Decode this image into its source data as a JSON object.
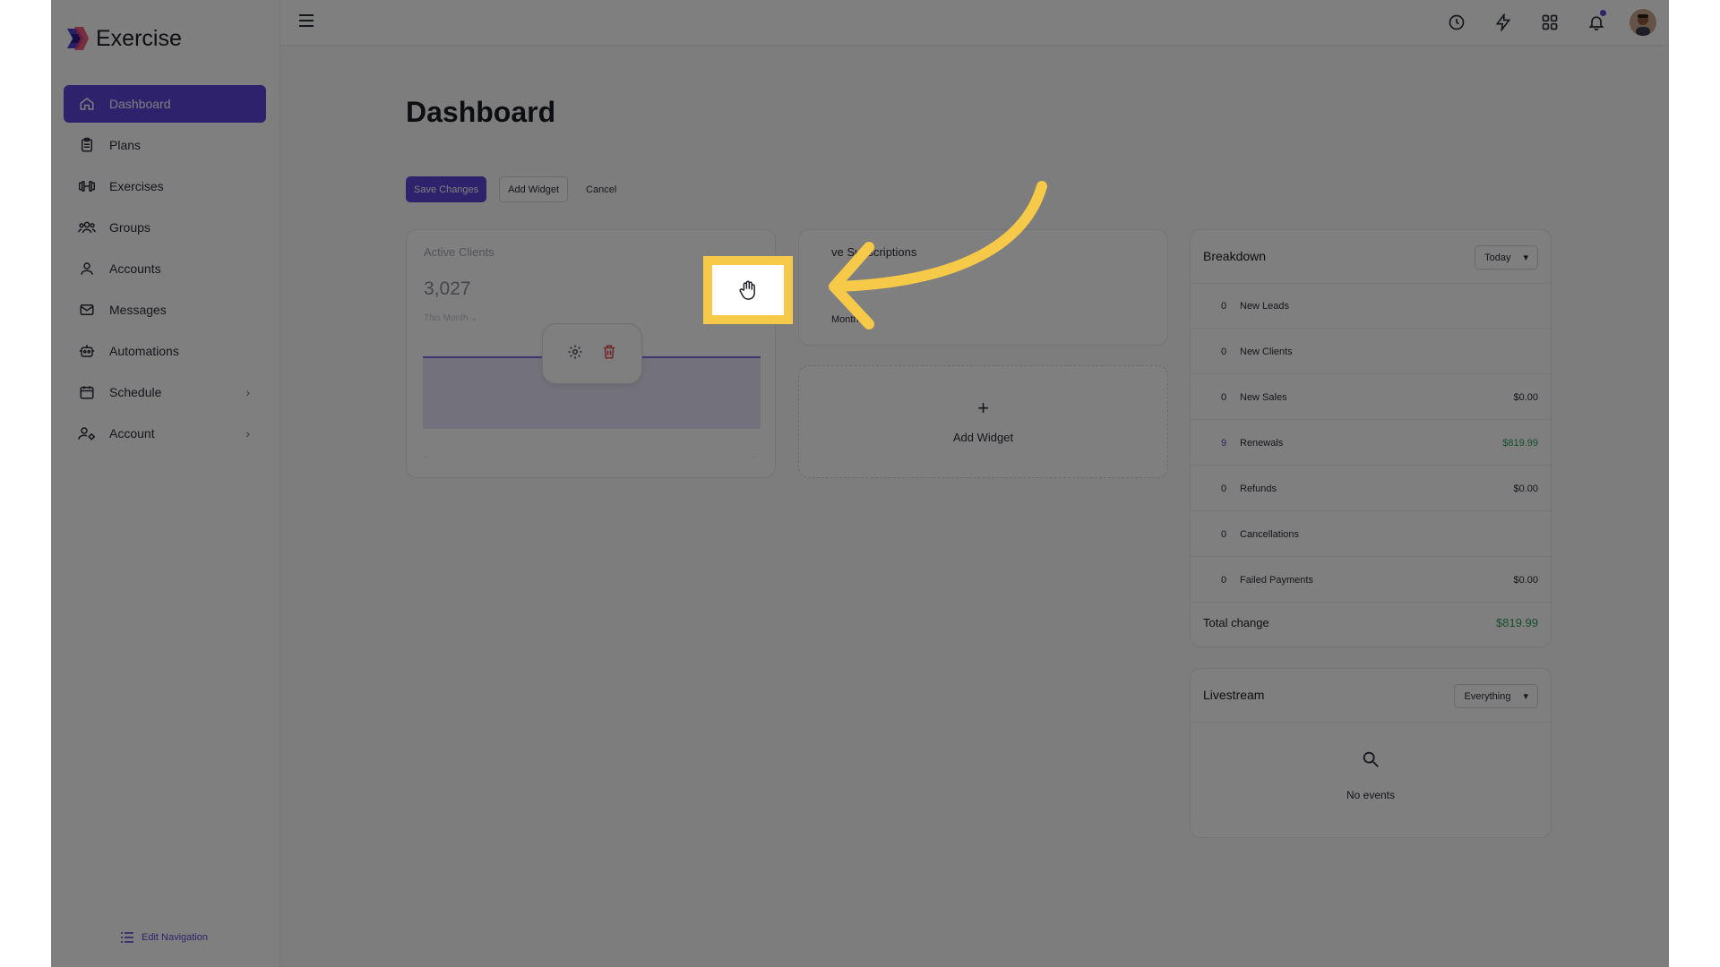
{
  "app": {
    "name": "Exercise"
  },
  "sidebar": {
    "items": [
      {
        "label": "Dashboard",
        "icon": "home-icon",
        "active": true
      },
      {
        "label": "Plans",
        "icon": "clipboard-icon"
      },
      {
        "label": "Exercises",
        "icon": "dumbbell-icon"
      },
      {
        "label": "Groups",
        "icon": "users-icon"
      },
      {
        "label": "Accounts",
        "icon": "user-icon"
      },
      {
        "label": "Messages",
        "icon": "mail-icon"
      },
      {
        "label": "Automations",
        "icon": "robot-icon"
      },
      {
        "label": "Schedule",
        "icon": "calendar-icon",
        "has_children": true
      },
      {
        "label": "Account",
        "icon": "user-gear-icon",
        "has_children": true
      }
    ],
    "edit_navigation": "Edit Navigation"
  },
  "page": {
    "title": "Dashboard"
  },
  "toolbar": {
    "save_changes": "Save Changes",
    "add_widget": "Add Widget",
    "cancel": "Cancel"
  },
  "widgets": {
    "active_clients": {
      "label": "Active Clients",
      "value": "3,027",
      "range": "This Month"
    },
    "active_subscriptions": {
      "label": "ve Subscriptions",
      "range": "Month"
    },
    "add_widget_label": "Add Widget"
  },
  "breakdown": {
    "title": "Breakdown",
    "period": "Today",
    "rows": [
      {
        "count": "0",
        "label": "New Leads",
        "amount": ""
      },
      {
        "count": "0",
        "label": "New Clients",
        "amount": ""
      },
      {
        "count": "0",
        "label": "New Sales",
        "amount": "$0.00"
      },
      {
        "count": "9",
        "label": "Renewals",
        "amount": "$819.99"
      },
      {
        "count": "0",
        "label": "Refunds",
        "amount": "$0.00"
      },
      {
        "count": "0",
        "label": "Cancellations",
        "amount": ""
      },
      {
        "count": "0",
        "label": "Failed Payments",
        "amount": "$0.00"
      }
    ],
    "total_label": "Total change",
    "total_amount": "$819.99"
  },
  "livestream": {
    "title": "Livestream",
    "filter": "Everything",
    "empty": "No events"
  },
  "colors": {
    "accent": "#5b45d6",
    "highlight": "#f7c948",
    "positive": "#2e9c5a",
    "danger": "#e04848"
  }
}
